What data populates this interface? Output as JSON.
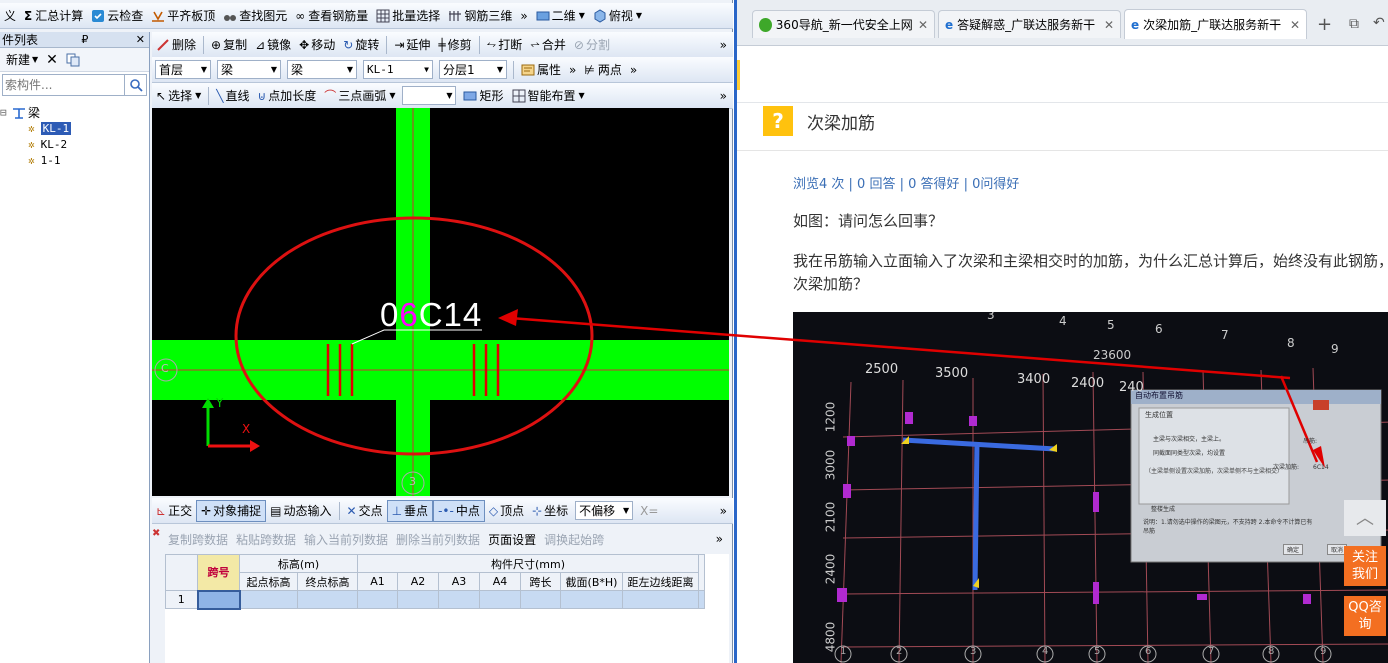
{
  "app": {
    "row1": [
      "义",
      "汇总计算",
      "云检查",
      "平齐板顶",
      "查找图元",
      "查看钢筋量",
      "批量选择",
      "钢筋三维",
      "二维",
      "俯视"
    ],
    "row2": [
      "删除",
      "复制",
      "镜像",
      "移动",
      "旋转",
      "延伸",
      "修剪",
      "打断",
      "合并",
      "分割"
    ],
    "row3_dd": [
      "首层",
      "梁",
      "梁",
      "KL-1",
      "分层1"
    ],
    "row3_prop": "属性",
    "row3_twopoint": "两点",
    "row4": [
      "选择",
      "直线",
      "点加长度",
      "三点画弧",
      "矩形",
      "智能布置"
    ],
    "comp_panel": {
      "title": "件列表",
      "new_label": "新建",
      "search_placeholder": "索构件...",
      "tree_root": "梁",
      "tree_items": [
        "KL-1",
        "KL-2",
        "1-1"
      ]
    },
    "canvas": {
      "rebar_label_a": "0",
      "rebar_label_b": "6",
      "rebar_label_c": "C14",
      "axis_left": "C",
      "axis_bottom": "3"
    },
    "status_bar": [
      "正交",
      "对象捕捉",
      "动态输入",
      "交点",
      "垂点",
      "中点",
      "顶点",
      "坐标",
      "不偏移",
      "X="
    ],
    "bottom_tools": [
      "复制跨数据",
      "粘贴跨数据",
      "输入当前列数据",
      "删除当前列数据",
      "页面设置",
      "调换起始跨"
    ],
    "table": {
      "col_span": "跨号",
      "group_elev": "标高(m)",
      "group_size": "构件尺寸(mm)",
      "cols": [
        "起点标高",
        "终点标高",
        "A1",
        "A2",
        "A3",
        "A4",
        "跨长",
        "截面(B*H)",
        "距左边线距离"
      ],
      "row1": "1"
    }
  },
  "browser": {
    "tabs": [
      "360导航_新一代安全上网导",
      "答疑解惑_广联达服务新干",
      "次梁加筋_广联达服务新干"
    ],
    "question_title": "次梁加筋",
    "stats": "浏览4 次 | 0 回答 | 0 答得好 | 0问得好",
    "p1": "如图：请问怎么回事？",
    "p2": "我在吊筋输入立面输入了次梁和主梁相交时的加筋，为什么汇总计算后，始终没有此钢筋，次梁加筋？",
    "photo": {
      "top_dims": [
        "2500",
        "3500",
        "3400",
        "2400",
        "240"
      ],
      "total_dim": "23600",
      "axis_nums": [
        "3",
        "4",
        "5",
        "6",
        "7",
        "8",
        "9"
      ],
      "left_dims": [
        "1200",
        "3000",
        "2100",
        "2400",
        "4800"
      ],
      "bottom_nums": [
        "1",
        "2",
        "3",
        "4",
        "5",
        "6",
        "7",
        "8",
        "9"
      ],
      "dialog_title": "自动布置吊筋",
      "dialog_group": "生成位置",
      "dialog_opt1": "主梁与次梁相交，主梁上。",
      "dialog_opt2": "同截面同类型次梁，均设置",
      "dialog_note": "（主梁单侧设置次梁加筋，次梁单侧不与主梁相交）",
      "dialog_field1": "吊筋:",
      "dialog_field2": "次梁加筋:",
      "dialog_field2_val": "6C14",
      "dialog_clear": "整楼生成",
      "dialog_desc": "说明：1.请勿选中操作的梁图元，不支持跨 2.本命令不计算已有吊筋",
      "dialog_ok": "确定",
      "dialog_cancel": "取消"
    },
    "follow": "关注我们",
    "qq": "QQ咨询"
  }
}
